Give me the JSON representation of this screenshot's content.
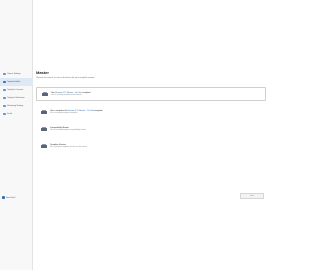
{
  "sidebar": {
    "items": [
      {
        "label": "Source Settings"
      },
      {
        "label": "Template Editor"
      },
      {
        "label": "Template Overview"
      },
      {
        "label": "Template Verification"
      },
      {
        "label": "Monitoring Settings"
      },
      {
        "label": "Finish"
      }
    ],
    "active_index": 1,
    "footer_label": "Need help?"
  },
  "main": {
    "title": "Master",
    "description": "Choose the source to use as the basis for your template master.",
    "options": [
      {
        "title_prefix": "Use",
        "title_link": "Harmon PC Master - On-Site",
        "title_suffix": "template",
        "subtitle": "Use an existing template from Harmon"
      },
      {
        "title_prefix": "Use a snapshot of",
        "title_link": "Harmon PC Master - On-Site",
        "title_suffix": "template",
        "subtitle": "Use an existing template snapshot"
      },
      {
        "title_prefix": "Compatibility Master",
        "title_link": "",
        "title_suffix": "",
        "subtitle": "Use an existing template compatibility master"
      },
      {
        "title_prefix": "Template Version",
        "title_link": "",
        "title_suffix": "",
        "subtitle": "Use a previous template version as the master"
      }
    ],
    "next_label": "Next"
  },
  "colors": {
    "accent": "#2f6db5",
    "active_bg": "#dfe9f5",
    "sidebar_bg": "#f8f8f9"
  }
}
